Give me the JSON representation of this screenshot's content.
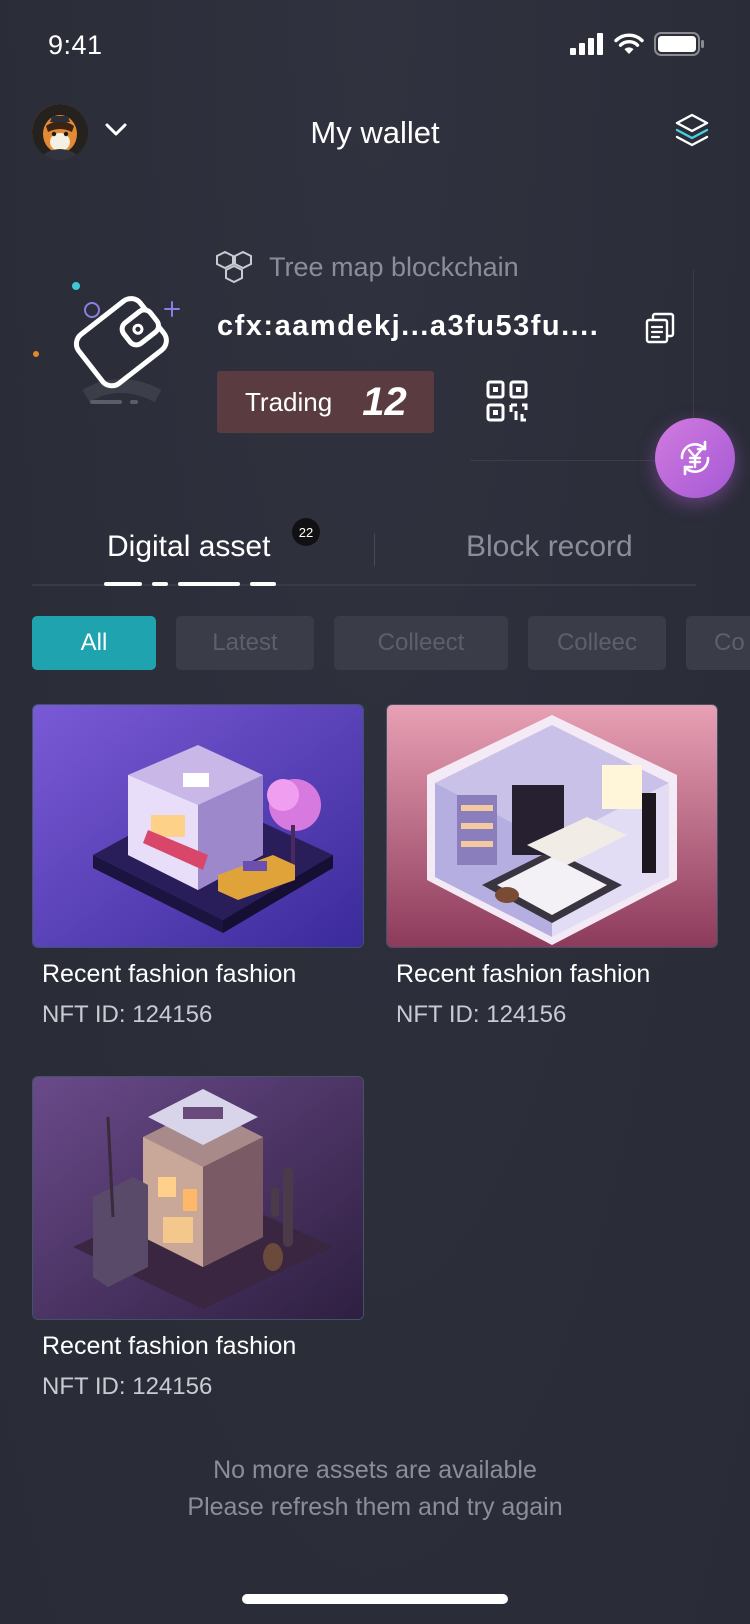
{
  "status_bar": {
    "time": "9:41"
  },
  "header": {
    "title": "My wallet"
  },
  "wallet": {
    "chain_name": "Tree map blockchain",
    "address": "cfx:aamdekj...a3fu53fu....",
    "trading_label": "Trading",
    "trading_count": "12"
  },
  "tabs": [
    {
      "label": "Digital asset",
      "badge": "22",
      "active": true
    },
    {
      "label": "Block record",
      "active": false
    }
  ],
  "filters": [
    {
      "label": "All",
      "active": true
    },
    {
      "label": "Latest",
      "active": false
    },
    {
      "label": "Colleect",
      "active": false
    },
    {
      "label": "Colleec",
      "active": false
    },
    {
      "label": "Co",
      "active": false
    }
  ],
  "nfts": [
    {
      "title": "Recent fashion fashion",
      "id_text": "NFT ID: 124156"
    },
    {
      "title": "Recent fashion fashion",
      "id_text": "NFT ID: 124156"
    },
    {
      "title": "Recent fashion fashion",
      "id_text": "NFT ID: 124156"
    }
  ],
  "empty_state": {
    "line1": "No more assets are available",
    "line2": "Please refresh them and try again"
  },
  "colors": {
    "background": "#2b2d39",
    "accent_teal": "#1fa3ae",
    "trading_badge": "#5a3b40",
    "exchange_button": "#c46ddc"
  },
  "icons": {
    "header_left": "chevron-down-icon",
    "header_right": "layers-icon",
    "chain": "hexagon-network-icon",
    "copy": "copy-icon",
    "qr": "qr-code-icon",
    "exchange": "yuan-exchange-icon"
  }
}
